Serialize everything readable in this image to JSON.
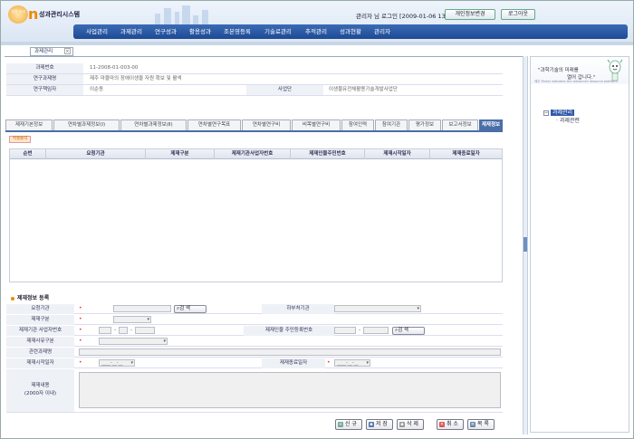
{
  "header": {
    "logo_bubble": "생명\n누리",
    "logo_letter": "n",
    "system_name": "성과관리시스템",
    "user_info": "관리자 님 로그인 [2009-01-06 13:04]",
    "profile_button": "개인정보변경",
    "logout_button": "로그아웃"
  },
  "nav": {
    "items": [
      "사업관리",
      "과제관리",
      "연구성과",
      "활용성과",
      "조본영등록",
      "기술료관리",
      "추적관리",
      "성과현황",
      "관리자"
    ]
  },
  "open_tab": {
    "label": "과제관리",
    "close": "×"
  },
  "project_info": {
    "rows": [
      {
        "label": "과제번호",
        "value": "11-2008-01-003-00"
      },
      {
        "label": "연구과제명",
        "value": "제주 마블마의 장애이생을 자원 확보 및 활색"
      },
      {
        "label": "연구책임자",
        "value": "이순동",
        "label2": "사업단",
        "value2": "이생물유전체활용기술개발사업단"
      }
    ]
  },
  "subtabs": {
    "items": [
      "제재기본정보",
      "연차별과제정보(Ⅰ)",
      "연차별과제정보(Ⅱ)",
      "연차별연구목표",
      "연차별연구비",
      "비목별연구비",
      "참여인력",
      "참여기관",
      "평가정보",
      "보고서정보",
      "제재정보"
    ],
    "active": "제재정보"
  },
  "excel_button": "엑셀출력",
  "grid": {
    "columns": [
      "순번",
      "요청기관",
      "제재구분",
      "제재기관사업자번호",
      "제재인물주민번호",
      "제재시작일자",
      "제재종료일자"
    ],
    "rows": []
  },
  "form": {
    "title": "제재정보 등록",
    "labels": {
      "requesting_org": "요청기관",
      "ministry": "하부처기관",
      "sanction_type": "제재구분",
      "org_biz_no": "제재기관 사업자번호",
      "person_id_no": "제재인물 주민등록번호",
      "reason_type": "제재사유구분",
      "related_project": "관련과제명",
      "start_date": "제재시작일자",
      "end_date": "제재종료일자",
      "content": "제재내용\n(2000자 이내)"
    },
    "search_label": "검 색",
    "date_placeholder": "____-__-__",
    "dash": "-"
  },
  "actions": {
    "new": "신 규",
    "save": "저 장",
    "delete": "삭 제",
    "cancel": "취 소",
    "list": "목 록"
  },
  "right_panel": {
    "slogan1": "\"과학기술의 미래를",
    "slogan2": "열어 갑니다.\"",
    "tiny": "제주 Portal indicates the advanced resource platform",
    "tree_root": "과제관리",
    "tree_child": "과제관련"
  },
  "colors": {
    "nav_bg": "#2b5aa3",
    "active_tab": "#4a6ea8",
    "accent_orange": "#f08a00",
    "required": "#e33333"
  }
}
